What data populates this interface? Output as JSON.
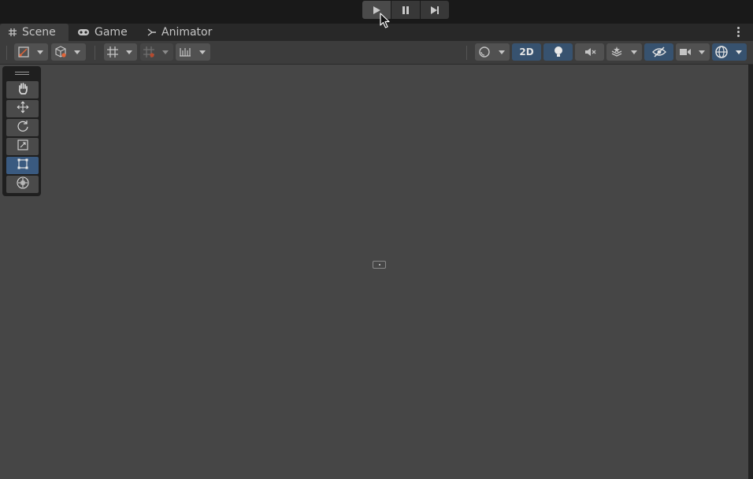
{
  "playbar": {
    "buttons": [
      {
        "name": "play",
        "icon": "play-icon"
      },
      {
        "name": "pause",
        "icon": "pause-icon"
      },
      {
        "name": "step",
        "icon": "step-icon"
      }
    ]
  },
  "tabs": [
    {
      "label": "Scene",
      "icon": "grid-hash-icon",
      "active": true
    },
    {
      "label": "Game",
      "icon": "gamepad-icon",
      "active": false
    },
    {
      "label": "Animator",
      "icon": "animator-icon",
      "active": false
    }
  ],
  "toolbar": {
    "left": [
      "draw-mode-icon",
      "shaded-cube-icon",
      "grid-snap-icon",
      "increment-snap-icon",
      "ruler-icon"
    ],
    "right": {
      "shading_icon": "sphere-icon",
      "mode_2d_label": "2D",
      "lighting_icon": "lightbulb-icon",
      "audio_icon": "audio-mute-icon",
      "effects_icon": "effects-icon",
      "visibility_icon": "eye-slash-icon",
      "camera_icon": "camera-icon",
      "gizmos_icon": "gizmo-globe-icon"
    }
  },
  "tools": [
    {
      "name": "hand",
      "icon": "hand-icon",
      "selected": false
    },
    {
      "name": "move",
      "icon": "move-icon",
      "selected": false
    },
    {
      "name": "rotate",
      "icon": "rotate-icon",
      "selected": false
    },
    {
      "name": "scale",
      "icon": "scale-icon",
      "selected": false
    },
    {
      "name": "rect",
      "icon": "rect-transform-icon",
      "selected": true
    },
    {
      "name": "transform",
      "icon": "transform-icon",
      "selected": false
    }
  ],
  "colors": {
    "background": "#191919",
    "viewport": "#464646",
    "toolbar": "#3c3c3c",
    "accent_blue": "#37526f",
    "selected_tool": "#3a5a80"
  }
}
